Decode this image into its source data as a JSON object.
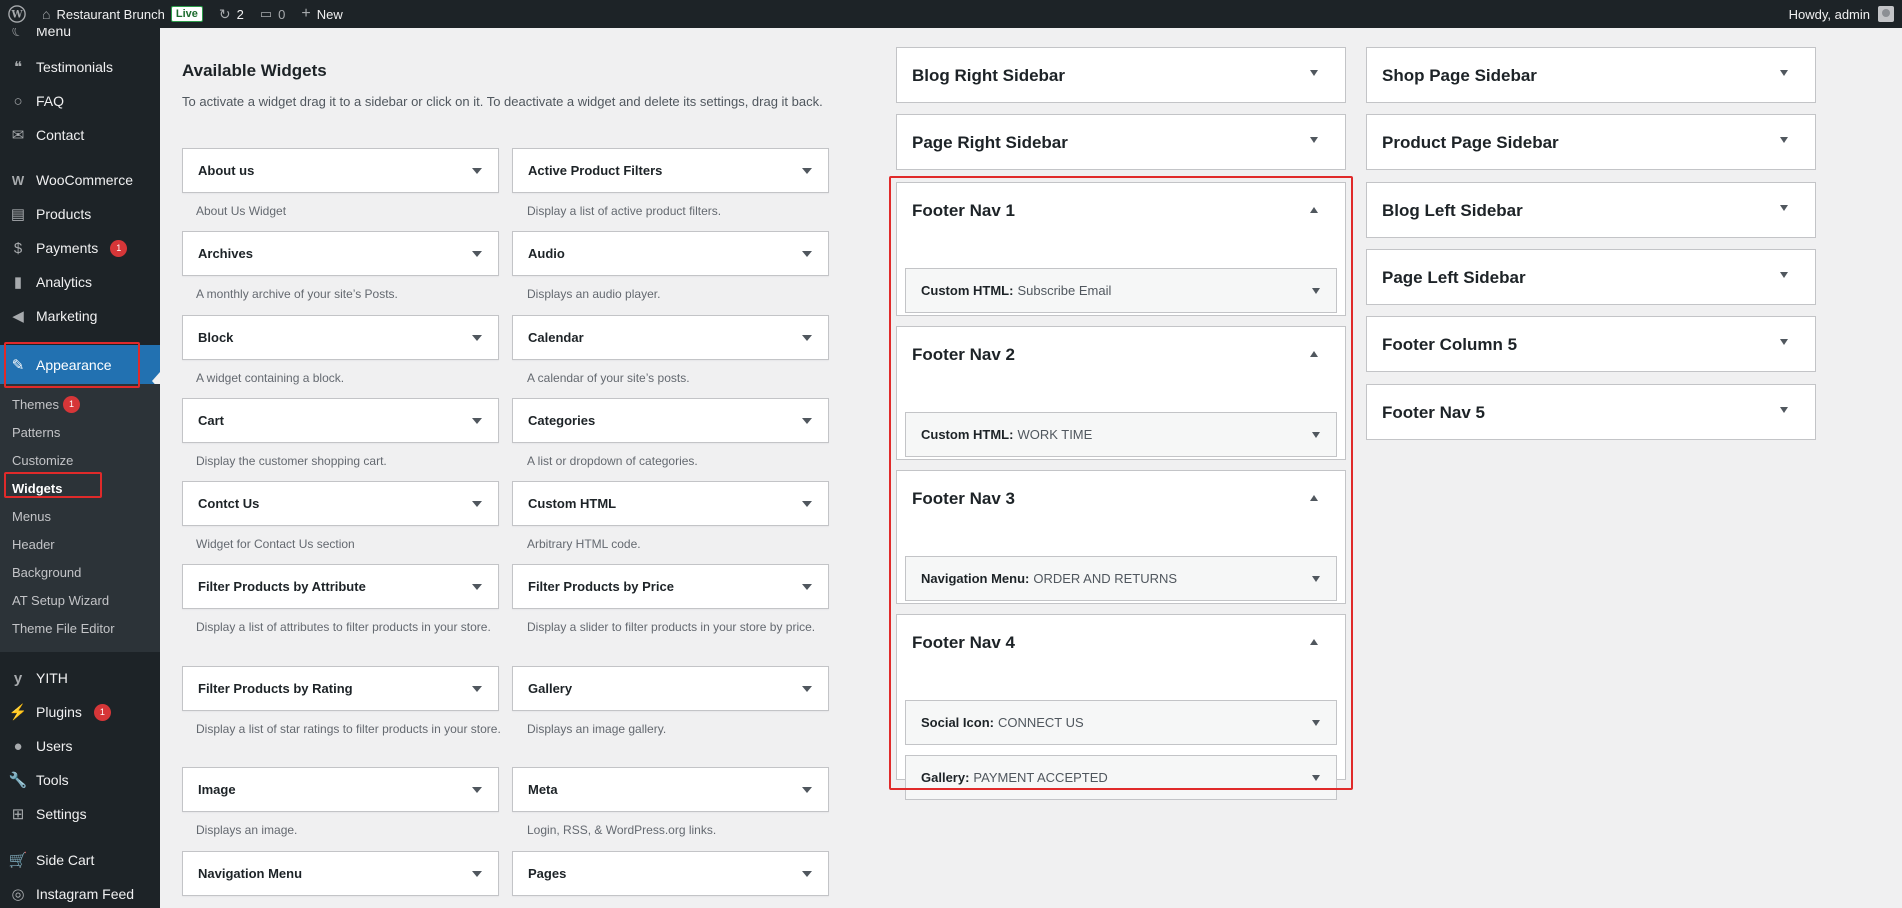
{
  "adminbar": {
    "site_name": "Restaurant Brunch",
    "live": "Live",
    "updates": "2",
    "comments": "0",
    "new": "New",
    "howdy": "Howdy, admin"
  },
  "menu": {
    "items": [
      {
        "label": "Menu"
      },
      {
        "label": "Testimonials"
      },
      {
        "label": "FAQ"
      },
      {
        "label": "Contact"
      },
      {
        "label": "WooCommerce"
      },
      {
        "label": "Products"
      },
      {
        "label": "Payments",
        "badge": "1"
      },
      {
        "label": "Analytics"
      },
      {
        "label": "Marketing"
      },
      {
        "label": "Appearance"
      },
      {
        "label": "YITH"
      },
      {
        "label": "Plugins",
        "badge": "1"
      },
      {
        "label": "Users"
      },
      {
        "label": "Tools"
      },
      {
        "label": "Settings"
      },
      {
        "label": "Side Cart"
      },
      {
        "label": "Instagram Feed"
      }
    ],
    "submenu": [
      {
        "label": "Themes",
        "badge": "1"
      },
      {
        "label": "Patterns"
      },
      {
        "label": "Customize"
      },
      {
        "label": "Widgets"
      },
      {
        "label": "Menus"
      },
      {
        "label": "Header"
      },
      {
        "label": "Background"
      },
      {
        "label": "AT Setup Wizard"
      },
      {
        "label": "Theme File Editor"
      }
    ]
  },
  "available": {
    "title": "Available Widgets",
    "description": "To activate a widget drag it to a sidebar or click on it. To deactivate a widget and delete its settings, drag it back.",
    "widgets": [
      {
        "name": "About us",
        "desc": "About Us Widget"
      },
      {
        "name": "Active Product Filters",
        "desc": "Display a list of active product filters."
      },
      {
        "name": "Archives",
        "desc": "A monthly archive of your site’s Posts."
      },
      {
        "name": "Audio",
        "desc": "Displays an audio player."
      },
      {
        "name": "Block",
        "desc": "A widget containing a block."
      },
      {
        "name": "Calendar",
        "desc": "A calendar of your site’s posts."
      },
      {
        "name": "Cart",
        "desc": "Display the customer shopping cart."
      },
      {
        "name": "Categories",
        "desc": "A list or dropdown of categories."
      },
      {
        "name": "Contct Us",
        "desc": "Widget for Contact Us section"
      },
      {
        "name": "Custom HTML",
        "desc": "Arbitrary HTML code."
      },
      {
        "name": "Filter Products by Attribute",
        "desc": "Display a list of attributes to filter products in your store."
      },
      {
        "name": "Filter Products by Price",
        "desc": "Display a slider to filter products in your store by price."
      },
      {
        "name": "Filter Products by Rating",
        "desc": "Display a list of star ratings to filter products in your store."
      },
      {
        "name": "Gallery",
        "desc": "Displays an image gallery."
      },
      {
        "name": "Image",
        "desc": "Displays an image."
      },
      {
        "name": "Meta",
        "desc": "Login, RSS, & WordPress.org links."
      },
      {
        "name": "Navigation Menu",
        "desc": ""
      },
      {
        "name": "Pages",
        "desc": ""
      }
    ]
  },
  "sidebars": {
    "blog_right": "Blog Right Sidebar",
    "page_right": "Page Right Sidebar",
    "footer_nav_1": {
      "title": "Footer Nav 1",
      "widgets": [
        {
          "type": "Custom HTML:",
          "title": "Subscribe Email"
        }
      ]
    },
    "footer_nav_2": {
      "title": "Footer Nav 2",
      "widgets": [
        {
          "type": "Custom HTML:",
          "title": "WORK TIME"
        }
      ]
    },
    "footer_nav_3": {
      "title": "Footer Nav 3",
      "widgets": [
        {
          "type": "Navigation Menu:",
          "title": "ORDER AND RETURNS"
        }
      ]
    },
    "footer_nav_4": {
      "title": "Footer Nav 4",
      "widgets": [
        {
          "type": "Social Icon:",
          "title": "CONNECT US"
        },
        {
          "type": "Gallery:",
          "title": "PAYMENT ACCEPTED"
        }
      ]
    },
    "shop_page": "Shop Page Sidebar",
    "product_page": "Product Page Sidebar",
    "blog_left": "Blog Left Sidebar",
    "page_left": "Page Left Sidebar",
    "footer_col_5": "Footer Column 5",
    "footer_nav_5": "Footer Nav 5"
  },
  "colors": {
    "admin_dark": "#1d2327",
    "accent": "#2271b1",
    "badge": "#d63638",
    "highlight": "#e02a2a"
  }
}
